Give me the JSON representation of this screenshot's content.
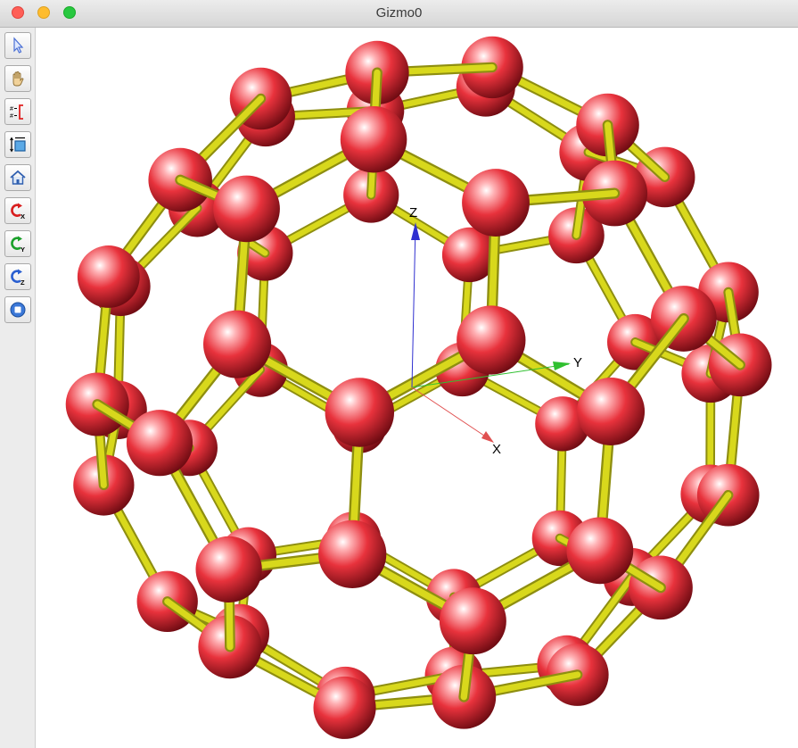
{
  "window": {
    "title": "Gizmo0"
  },
  "toolbar": {
    "tools": [
      {
        "icon": "pointer-arrow-icon"
      },
      {
        "icon": "pan-hand-icon"
      },
      {
        "icon": "measure-bracket-icon"
      },
      {
        "icon": "zoom-frame-icon"
      },
      {
        "icon": "home-icon"
      },
      {
        "icon": "rotate-x-icon",
        "label": "X"
      },
      {
        "icon": "rotate-y-icon",
        "label": "Y"
      },
      {
        "icon": "rotate-z-icon",
        "label": "Z"
      },
      {
        "icon": "stop-icon"
      }
    ]
  },
  "scene": {
    "axes": {
      "x": "X",
      "y": "Y",
      "z": "Z"
    },
    "colors": {
      "atom": "#e8323c",
      "single_bond": "#4a6fd4",
      "double_bond": "#d8d81c",
      "x_axis": "#e05050",
      "y_axis": "#30c030",
      "z_axis": "#3030d0"
    }
  }
}
